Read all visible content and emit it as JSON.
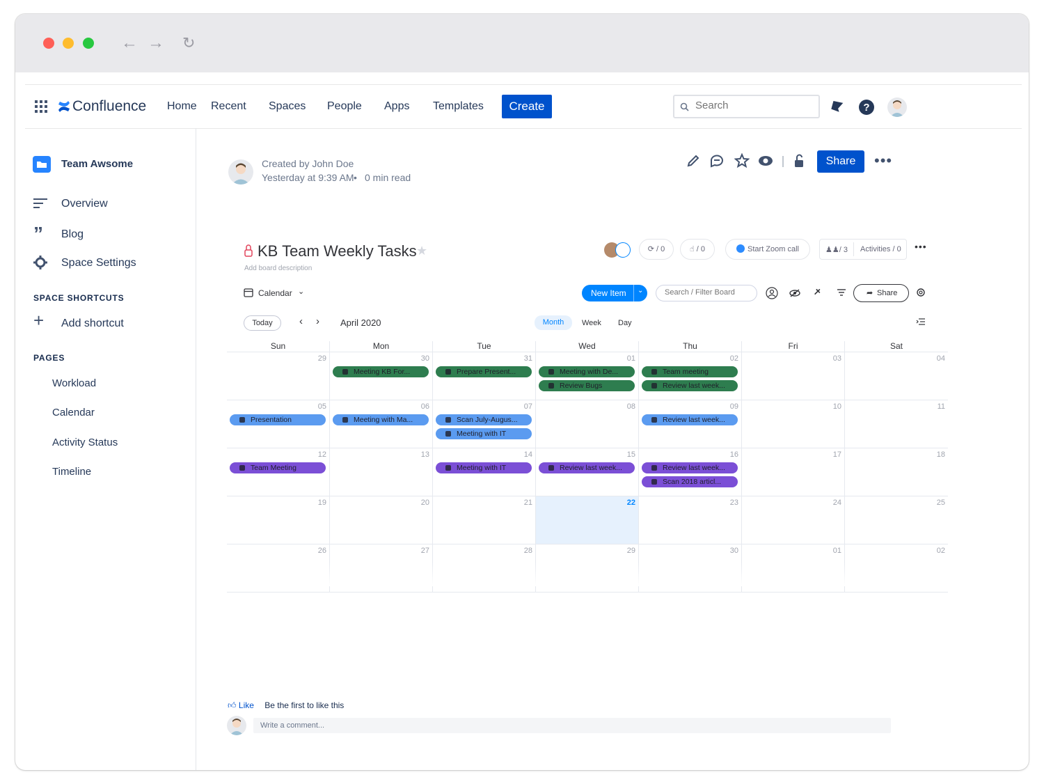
{
  "nav": {
    "app_name": "Confluence",
    "items": [
      "Home",
      "Recent",
      "Spaces",
      "People",
      "Apps",
      "Templates"
    ],
    "create_label": "Create",
    "search_placeholder": "Search"
  },
  "sidebar": {
    "space_name": "Team Awsome",
    "items": [
      "Overview",
      "Blog",
      "Space Settings"
    ],
    "shortcuts_heading": "SPACE SHORTCUTS",
    "add_shortcut": "Add shortcut",
    "pages_heading": "PAGES",
    "pages": [
      "Workload",
      "Calendar",
      "Activity Status",
      "Timeline"
    ]
  },
  "page_meta": {
    "created_by": "Created by John Doe",
    "time": "Yesterday at 9:39 AM",
    "separator": "•",
    "read_time": "0 min read",
    "share_label": "Share"
  },
  "board": {
    "title": "KB Team Weekly Tasks",
    "description": "Add board description",
    "updates_count": "/ 0",
    "likes_count": "/ 0",
    "zoom_label": "Start Zoom call",
    "members_count": "/ 3",
    "activities_label": "Activities / 0",
    "view_label": "Calendar",
    "new_item_label": "New Item",
    "filter_placeholder": "Search / Filter Board",
    "share_label": "Share"
  },
  "calendar": {
    "today_label": "Today",
    "month_label": "April 2020",
    "views": [
      "Month",
      "Week",
      "Day"
    ],
    "active_view": "Month",
    "day_names": [
      "Sun",
      "Mon",
      "Tue",
      "Wed",
      "Thu",
      "Fri",
      "Sat"
    ],
    "weeks": [
      [
        "29",
        "30",
        "31",
        "01",
        "02",
        "03",
        "04"
      ],
      [
        "05",
        "06",
        "07",
        "08",
        "09",
        "10",
        "11"
      ],
      [
        "12",
        "13",
        "14",
        "15",
        "16",
        "17",
        "18"
      ],
      [
        "19",
        "20",
        "21",
        "22",
        "23",
        "24",
        "25"
      ],
      [
        "26",
        "27",
        "28",
        "29",
        "30",
        "01",
        "02"
      ]
    ],
    "today_cell": "22",
    "events": [
      {
        "week": 0,
        "day": 1,
        "slot": 0,
        "color": "green",
        "label": "Meeting KB For..."
      },
      {
        "week": 0,
        "day": 2,
        "slot": 0,
        "color": "green",
        "label": "Prepare Present..."
      },
      {
        "week": 0,
        "day": 3,
        "slot": 0,
        "color": "green",
        "label": "Meeting with De..."
      },
      {
        "week": 0,
        "day": 3,
        "slot": 1,
        "color": "green",
        "label": "Review Bugs"
      },
      {
        "week": 0,
        "day": 4,
        "slot": 0,
        "color": "green",
        "label": "Team meeting"
      },
      {
        "week": 0,
        "day": 4,
        "slot": 1,
        "color": "green",
        "label": "Review last week..."
      },
      {
        "week": 1,
        "day": 0,
        "slot": 0,
        "color": "blue",
        "label": "Presentation"
      },
      {
        "week": 1,
        "day": 1,
        "slot": 0,
        "color": "blue",
        "label": "Meeting with Ma..."
      },
      {
        "week": 1,
        "day": 2,
        "slot": 0,
        "color": "blue",
        "label": "Scan July-Augus..."
      },
      {
        "week": 1,
        "day": 2,
        "slot": 1,
        "color": "blue",
        "label": "Meeting with IT"
      },
      {
        "week": 1,
        "day": 4,
        "slot": 0,
        "color": "blue",
        "label": "Review last week..."
      },
      {
        "week": 2,
        "day": 0,
        "slot": 0,
        "color": "purple",
        "label": "Team Meeting"
      },
      {
        "week": 2,
        "day": 2,
        "slot": 0,
        "color": "purple",
        "label": "Meeting with IT"
      },
      {
        "week": 2,
        "day": 3,
        "slot": 0,
        "color": "purple",
        "label": "Review last week..."
      },
      {
        "week": 2,
        "day": 4,
        "slot": 0,
        "color": "purple",
        "label": "Review last week..."
      },
      {
        "week": 2,
        "day": 4,
        "slot": 1,
        "color": "purple",
        "label": "Scan 2018 articl..."
      }
    ]
  },
  "footer": {
    "like_label": "Like",
    "like_text": "Be the first to like this",
    "comment_placeholder": "Write a comment..."
  },
  "colors": {
    "primary": "#0052cc",
    "monday_blue": "#0085ff",
    "event_green": "#2e7d4f",
    "event_blue": "#5b9bf0",
    "event_purple": "#7b4fd6",
    "today_bg": "#e6f1fd"
  }
}
